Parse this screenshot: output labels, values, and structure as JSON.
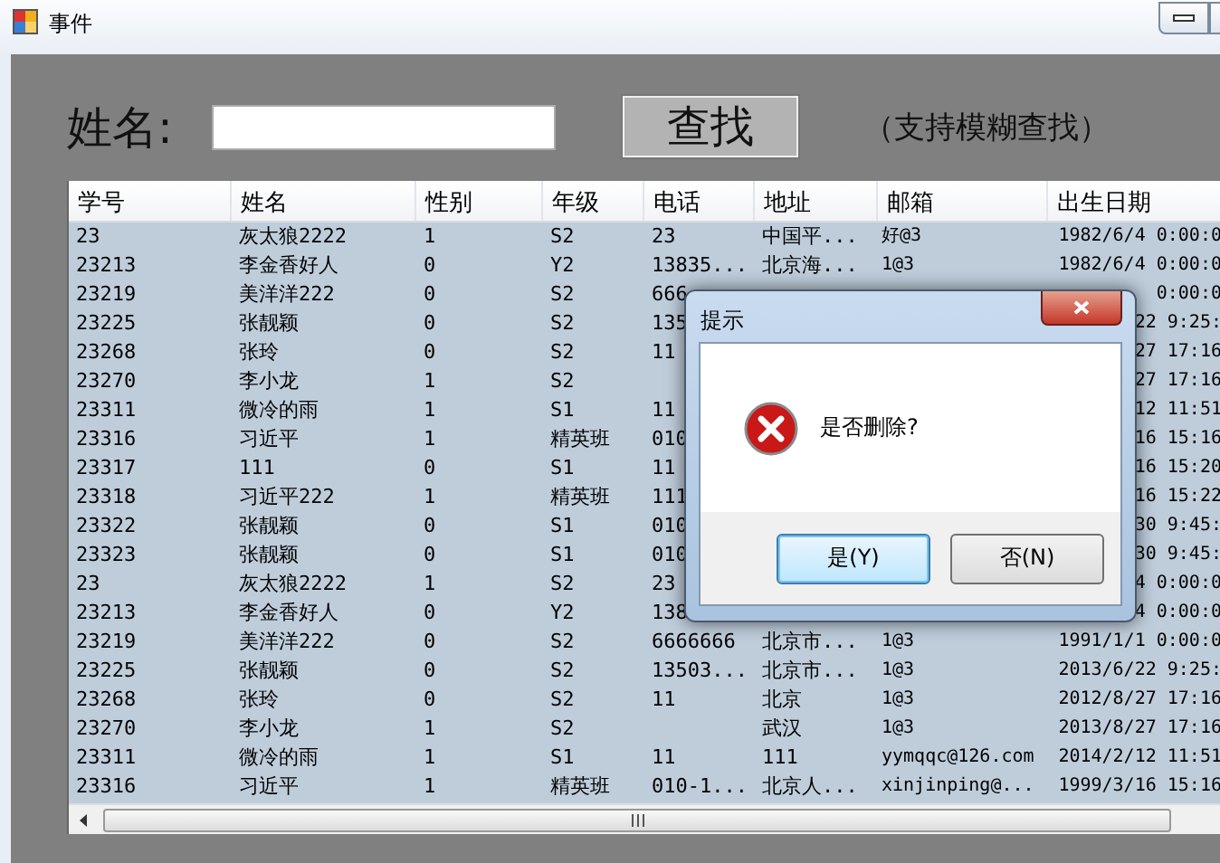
{
  "window": {
    "title": "事件"
  },
  "search": {
    "label": "姓名:",
    "button": "查找",
    "hint": "（支持模糊查找）"
  },
  "table": {
    "columns": [
      "学号",
      "姓名",
      "性别",
      "年级",
      "电话",
      "地址",
      "邮箱",
      "出生日期"
    ],
    "rows": [
      [
        "23",
        "灰太狼2222",
        "1",
        "S2",
        "23",
        "中国平...",
        "好@3",
        "1982/6/4 0:00:0"
      ],
      [
        "23213",
        "李金香好人",
        "0",
        "Y2",
        "13835...",
        "北京海...",
        "1@3",
        "1982/6/4 0:00:0"
      ],
      [
        "23219",
        "美洋洋222",
        "0",
        "S2",
        "666",
        null,
        null,
        "0:00:0"
      ],
      [
        "23225",
        "张靓颖",
        "0",
        "S2",
        "135",
        null,
        null,
        "22 9:25:"
      ],
      [
        "23268",
        "张玲",
        "0",
        "S2",
        "11",
        null,
        null,
        "27 17:16"
      ],
      [
        "23270",
        "李小龙",
        "1",
        "S2",
        null,
        null,
        null,
        "27 17:16"
      ],
      [
        "23311",
        "微冷的雨",
        "1",
        "S1",
        "11",
        null,
        null,
        "12 11:51"
      ],
      [
        "23316",
        "习近平",
        "1",
        "精英班",
        "010",
        null,
        null,
        "16 15:16"
      ],
      [
        "23317",
        "111",
        "0",
        "S1",
        "11",
        null,
        null,
        "16 15:20"
      ],
      [
        "23318",
        "习近平222",
        "1",
        "精英班",
        "111",
        null,
        null,
        "16 15:22"
      ],
      [
        "23322",
        "张靓颖",
        "0",
        "S1",
        "010",
        null,
        null,
        "30 9:45:"
      ],
      [
        "23323",
        "张靓颖",
        "0",
        "S1",
        "010",
        null,
        null,
        "30 9:45:"
      ],
      [
        "23",
        "灰太狼2222",
        "1",
        "S2",
        "23",
        null,
        null,
        "4 0:00:0"
      ],
      [
        "23213",
        "李金香好人",
        "0",
        "Y2",
        "138",
        null,
        null,
        "4 0:00:0"
      ],
      [
        "23219",
        "美洋洋222",
        "0",
        "S2",
        "6666666",
        "北京市...",
        "1@3",
        "1991/1/1 0:00:0"
      ],
      [
        "23225",
        "张靓颖",
        "0",
        "S2",
        "13503...",
        "北京市...",
        "1@3",
        "2013/6/22 9:25:"
      ],
      [
        "23268",
        "张玲",
        "0",
        "S2",
        "11",
        "北京",
        "1@3",
        "2012/8/27 17:16"
      ],
      [
        "23270",
        "李小龙",
        "1",
        "S2",
        null,
        "武汉",
        "1@3",
        "2013/8/27 17:16"
      ],
      [
        "23311",
        "微冷的雨",
        "1",
        "S1",
        "11",
        "111",
        "yymqqc@126.com",
        "2014/2/12 11:51"
      ],
      [
        "23316",
        "习近平",
        "1",
        "精英班",
        "010-1...",
        "北京人...",
        "xinjinping@...",
        "1999/3/16 15:16"
      ]
    ]
  },
  "dialog": {
    "title": "提示",
    "message": "是否删除?",
    "buttons": [
      {
        "label": "是(Y)",
        "selected": true
      },
      {
        "label": "否(N)",
        "selected": false
      }
    ]
  }
}
